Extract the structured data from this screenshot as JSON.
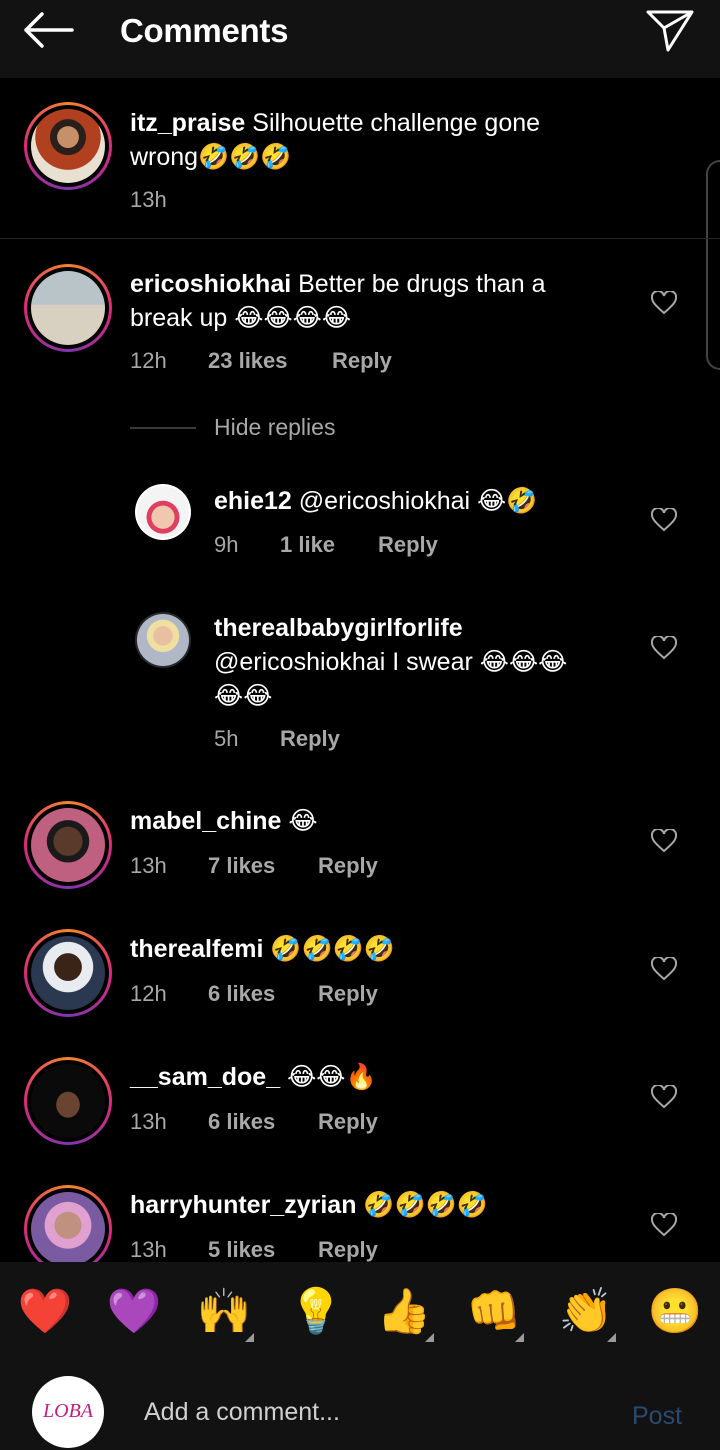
{
  "header": {
    "title": "Comments",
    "back_icon": "arrow-left-icon",
    "send_icon": "paper-plane-icon"
  },
  "caption": {
    "username": "itz_praise",
    "text_line1": "Silhouette challenge gone",
    "text_line2": "wrong🤣🤣🤣",
    "time": "13h"
  },
  "comments": [
    {
      "username": "ericoshiokhai",
      "text_line1": "Better be drugs than a",
      "text_line2": "break up 😂😂😂😂",
      "time": "12h",
      "likes": "23 likes",
      "reply": "Reply"
    },
    {
      "username": "mabel_chine",
      "text": "😂",
      "time": "13h",
      "likes": "7 likes",
      "reply": "Reply"
    },
    {
      "username": "therealfemi",
      "text": "🤣🤣🤣🤣",
      "time": "12h",
      "likes": "6 likes",
      "reply": "Reply"
    },
    {
      "username": "__sam_doe_",
      "text": "😂😂🔥",
      "time": "13h",
      "likes": "6 likes",
      "reply": "Reply"
    },
    {
      "username": "harryhunter_zyrian",
      "text": "🤣🤣🤣🤣",
      "time": "13h",
      "likes": "5 likes",
      "reply": "Reply"
    }
  ],
  "hide_replies": "Hide replies",
  "replies": [
    {
      "username": "ehie12",
      "text": "@ericoshiokhai 😂🤣",
      "time": "9h",
      "likes": "1 like",
      "reply": "Reply"
    },
    {
      "username": "therealbabygirlforlife",
      "text_line1": "@ericoshiokhai I swear 😂😂😂",
      "text_line2": "😂😂",
      "time": "5h",
      "reply": "Reply"
    }
  ],
  "emoji_bar": [
    "❤️",
    "💜",
    "🙌",
    "💡",
    "👍",
    "👊",
    "👏",
    "😬"
  ],
  "composer": {
    "avatar_text": "LOBA",
    "placeholder": "Add a comment...",
    "post_label": "Post"
  },
  "colors": {
    "background": "#000000",
    "muted_text": "#a8a8a8",
    "post_disabled": "#2c4a70"
  }
}
